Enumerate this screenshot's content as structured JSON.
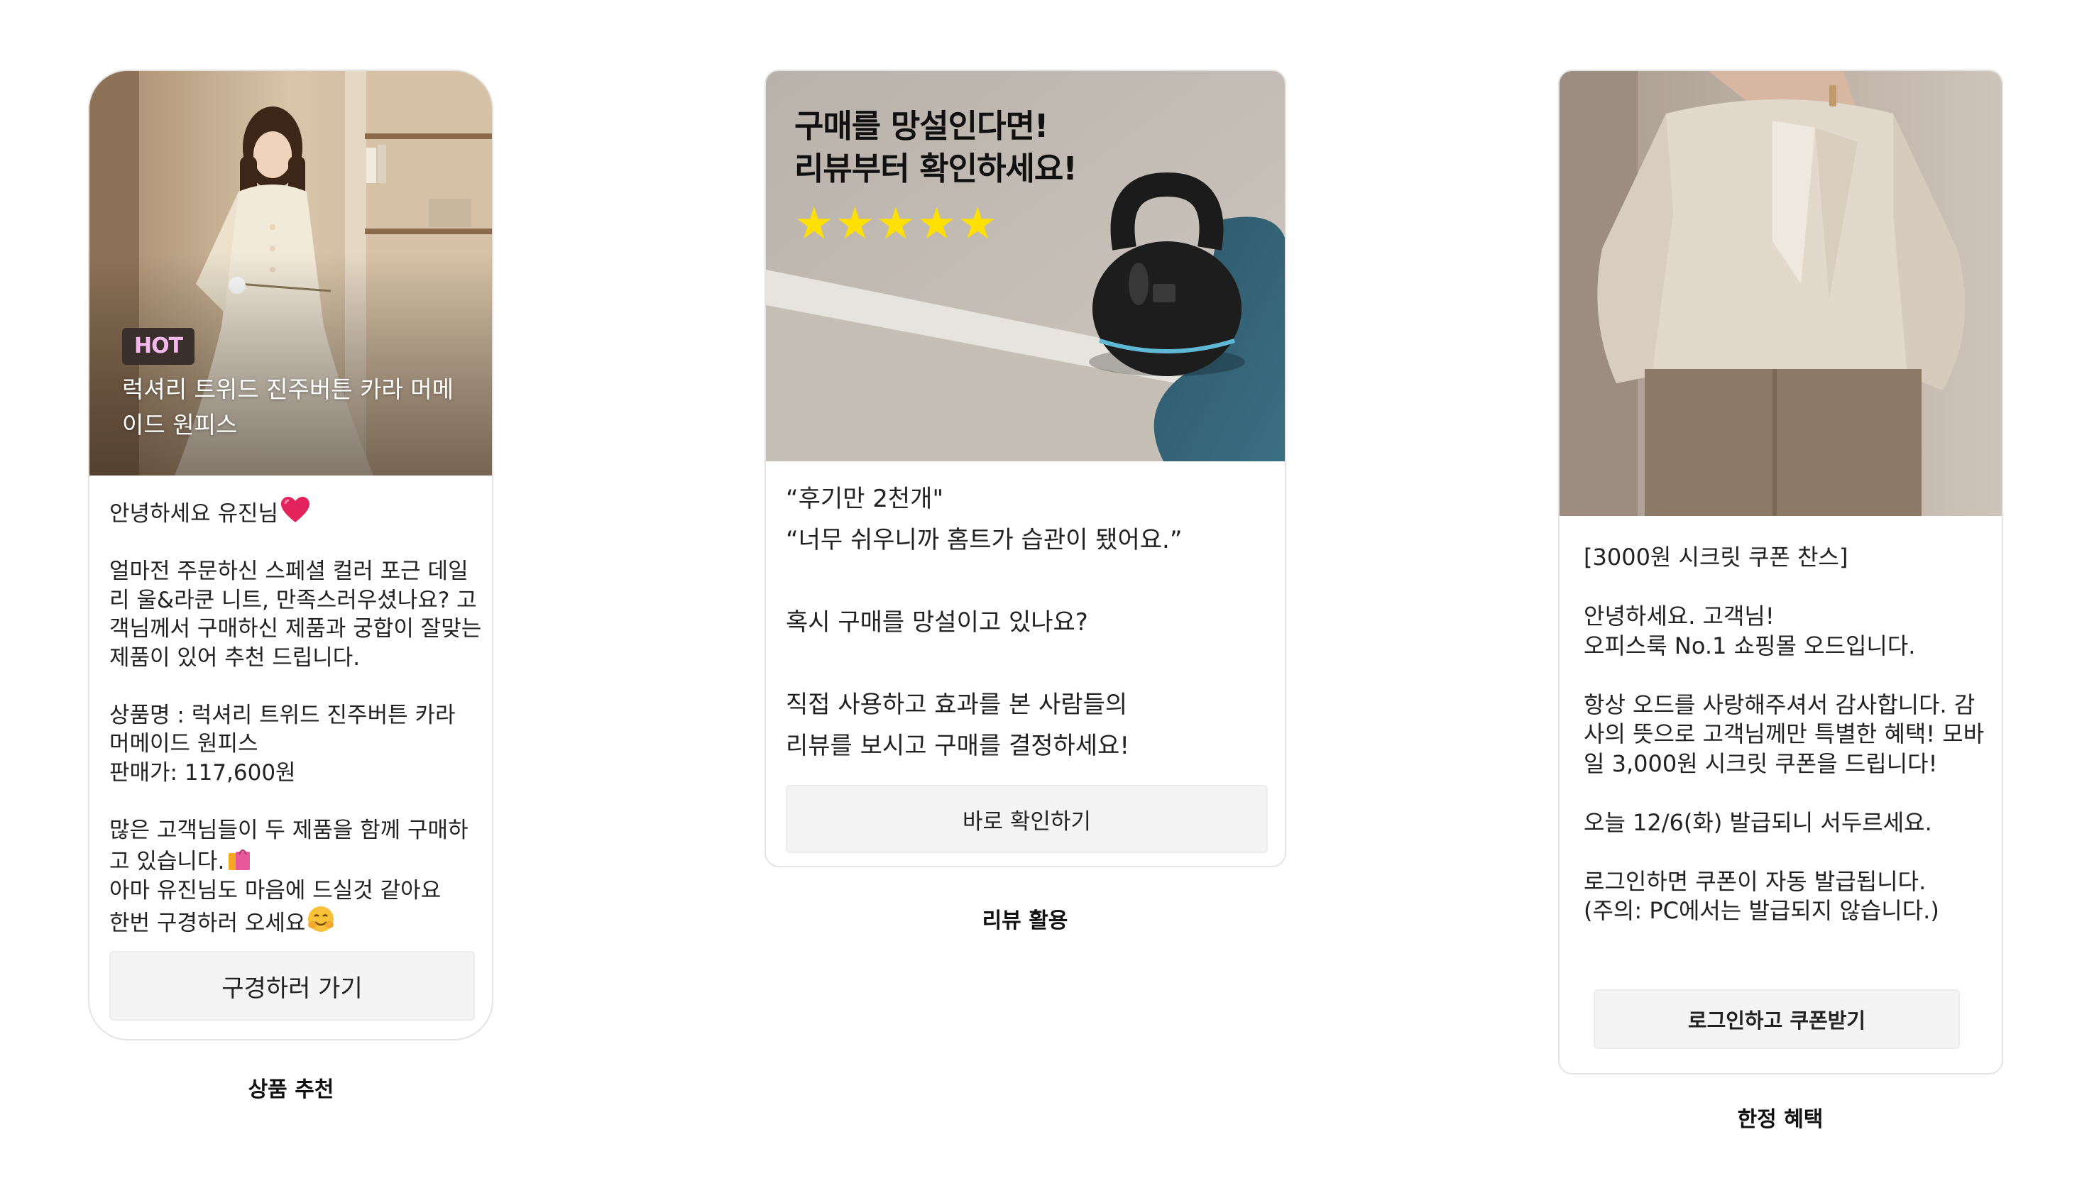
{
  "card1": {
    "badge": "HOT",
    "image_title": "럭셔리 트위드 진주버튼 카라 머메이드 원피스",
    "greeting": "안녕하세요 유진님",
    "paragraph1": "얼마전 주문하신 스페셜 컬러 포근 데일리 울&라쿤 니트, 만족스러우셨나요? 고객님께서 구매하신 제품과 궁합이 잘맞는 제품이 있어 추천 드립니다.",
    "product_name": "상품명 : 럭셔리 트위드 진주버튼 카라 머메이드 원피스",
    "price": "판매가: 117,600원",
    "paragraph3_line1": "많은 고객님들이 두 제품을 함께 구매하고 있습니다.",
    "paragraph3_line2": "아마 유진님도 마음에 드실것 같아요",
    "paragraph3_line3": "한번 구경하러 오세요",
    "button_label": "구경하러 가기",
    "caption": "상품 추천",
    "icons": [
      "heart-emoji-icon",
      "shopping-bags-emoji-icon",
      "smiling-face-emoji-icon"
    ]
  },
  "card2": {
    "overlay_line1": "구매를 망설인다면!",
    "overlay_line2": "리뷰부터 확인하세요!",
    "stars": "★★★★★",
    "quote1": "“후기만 2천개\"",
    "quote2": "“너무 쉬우니까 홈트가 습관이 됐어요.”",
    "question": "혹시 구매를 망설이고 있나요?",
    "body_line1": "직접 사용하고 효과를 본 사람들의",
    "body_line2": "리뷰를 보시고 구매를 결정하세요!",
    "button_label": "바로 확인하기",
    "caption": "리뷰 활용"
  },
  "card3": {
    "heading": "[3000원 시크릿 쿠폰 찬스]",
    "line1": "안녕하세요. 고객님!",
    "line2": "오피스룩 No.1 쇼핑몰 오드입니다.",
    "para2": "항상 오드를 사랑해주셔서 감사합니다. 감사의 뜻으로 고객님께만 특별한 혜택! 모바일 3,000원 시크릿 쿠폰을 드립니다!",
    "para3": "오늘 12/6(화) 발급되니 서두르세요.",
    "line4": "로그인하면 쿠폰이 자동 발급됩니다.",
    "line5": "(주의: PC에서는 발급되지 않습니다.)",
    "button_label": "로그인하고 쿠폰받기",
    "caption": "한정 혜택"
  },
  "colors": {
    "hot_text": "#f3b8ec",
    "star": "#ffe000",
    "button_bg": "#f4f4f5",
    "card_border": "#e4e4e4"
  }
}
